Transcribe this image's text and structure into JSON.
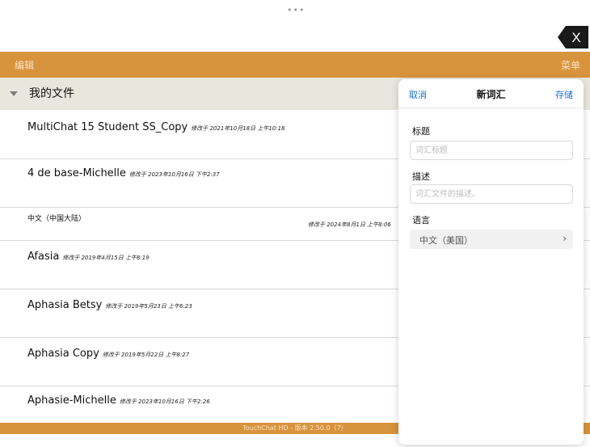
{
  "top_bar": {
    "drag_handle": "•••",
    "close_label": "X"
  },
  "toolbar": {
    "edit_label": "编辑",
    "menu_label": "菜单"
  },
  "group": {
    "title": "我的文件"
  },
  "files": [
    {
      "name": "MultiChat 15 Student SS_Copy",
      "modified": "修改于 2021年10月18日 上午10:18"
    },
    {
      "name": "4 de base-Michelle",
      "modified": "修改于 2023年10月16日 下午2:37"
    },
    {
      "name": "中文（中国大陆）",
      "modified": "修改于 2024年8月1日 上午8:06"
    },
    {
      "name": "Afasia",
      "modified": "修改于 2019年4月15日 上午8:19"
    },
    {
      "name": "Aphasia Betsy",
      "modified": "修改于 2019年5月23日 上午6:23"
    },
    {
      "name": "Aphasia Copy",
      "modified": "修改于 2019年5月22日 上午8:27"
    },
    {
      "name": "Aphasie-Michelle",
      "modified": "修改于 2023年10月16日 下午2:26"
    }
  ],
  "footer": {
    "text": "TouchChat HD - 版本 2.50.0（7）"
  },
  "popover": {
    "cancel_label": "取消",
    "title": "新词汇",
    "save_label": "存储",
    "title_field": {
      "label": "标题",
      "placeholder": "词汇标题",
      "value": ""
    },
    "description_field": {
      "label": "描述",
      "placeholder": "词汇文件的描述。",
      "value": ""
    },
    "language_field": {
      "label": "语言",
      "selected": "中文（美国）",
      "chevron": "›"
    }
  },
  "colors": {
    "accent_orange": "#d8933d",
    "group_header_bg": "#e8e7dd",
    "link_blue": "#1f6fd1"
  }
}
